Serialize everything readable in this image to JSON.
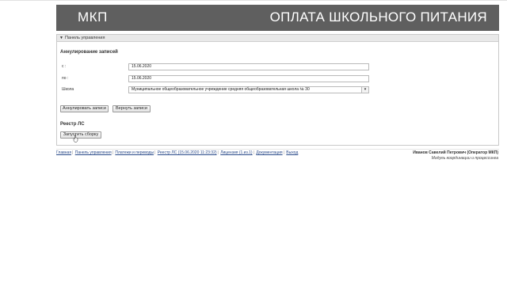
{
  "header": {
    "logo": "МКП",
    "title": "ОПЛАТА ШКОЛЬНОГО ПИТАНИЯ"
  },
  "panel": {
    "title": "Панель управления",
    "toggle_icon": "triangle-down-icon"
  },
  "cancel_section": {
    "title": "Аннулирование записей",
    "from_label": "с :",
    "from_value": "15.06.2020",
    "to_label": "по :",
    "to_value": "15.06.2020",
    "school_label": "Школа",
    "school_value": "Муниципальное общеобразовательное учреждение средняя общеобразовательная школа № 30",
    "cancel_button": "Аннулировать записи",
    "restore_button": "Вернуть записи"
  },
  "registry_section": {
    "title": "Реестр ЛС",
    "start_button": "Запустить сборку"
  },
  "footer": {
    "links": [
      "Главная",
      "Панель управления",
      "Платежи и переводы",
      "Реестр ЛС (15.06.2020 11:23:32)",
      "Лицензия (1.из.1)",
      "Документация",
      "Выход"
    ],
    "user": "Иванов Савелий Петрович (Оператор МКП)",
    "module": "Модуль координации и процессинга"
  }
}
